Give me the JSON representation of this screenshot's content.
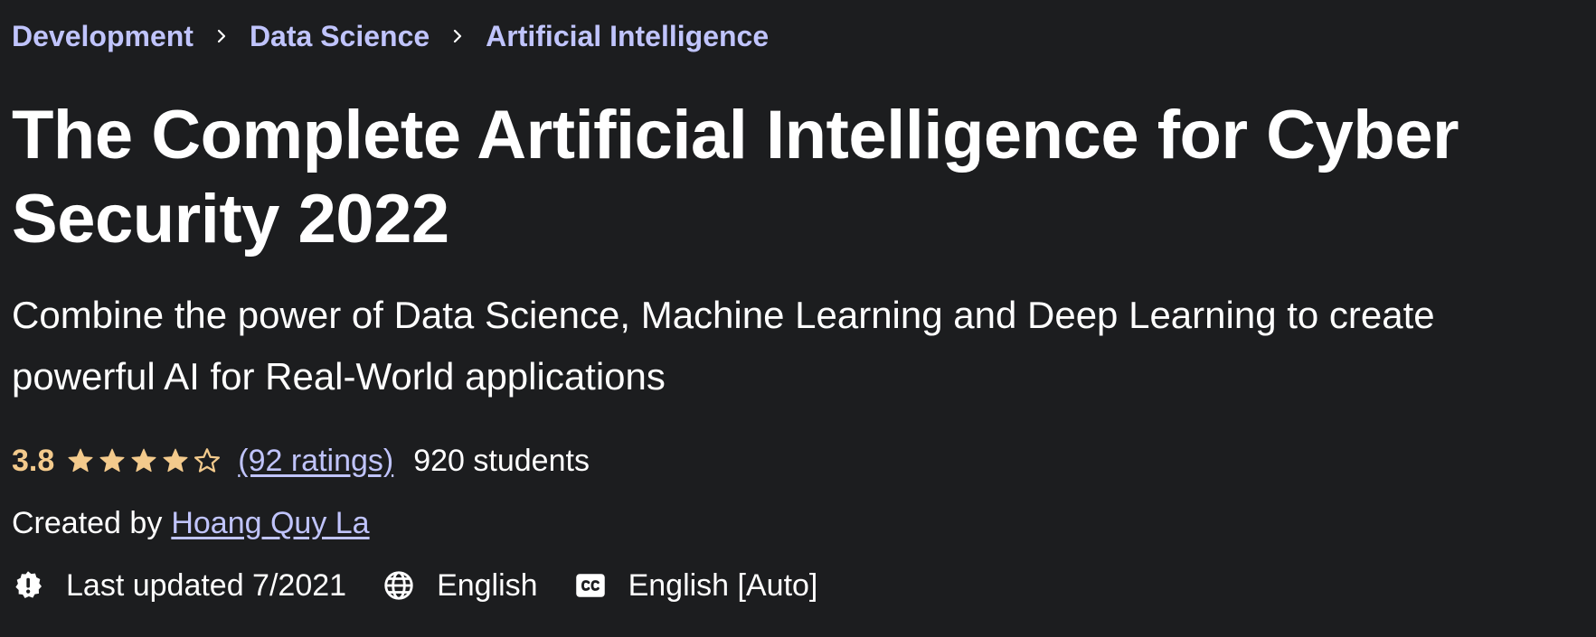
{
  "breadcrumb": {
    "items": [
      {
        "label": "Development"
      },
      {
        "label": "Data Science"
      },
      {
        "label": "Artificial Intelligence"
      }
    ],
    "separator_icon": "chevron-right-icon"
  },
  "course": {
    "title": "The Complete Artificial Intelligence for Cyber Security 2022",
    "subtitle": "Combine the power of Data Science, Machine Learning and Deep Learning to create powerful AI for Real-World applications"
  },
  "rating": {
    "value": "3.8",
    "stars_filled": 4,
    "stars_total": 5,
    "ratings_link": "(92 ratings)",
    "students": "920 students"
  },
  "created": {
    "label": "Created by",
    "instructor": "Hoang Quy La"
  },
  "meta": {
    "last_updated": "Last updated 7/2021",
    "language": "English",
    "captions": "English [Auto]",
    "icons": [
      "alert-badge-icon",
      "globe-icon",
      "closed-captions-icon"
    ]
  },
  "colors": {
    "background": "#1c1d1f",
    "link": "#c0c4fc",
    "rating": "#f3ca8c",
    "text": "#ffffff"
  }
}
